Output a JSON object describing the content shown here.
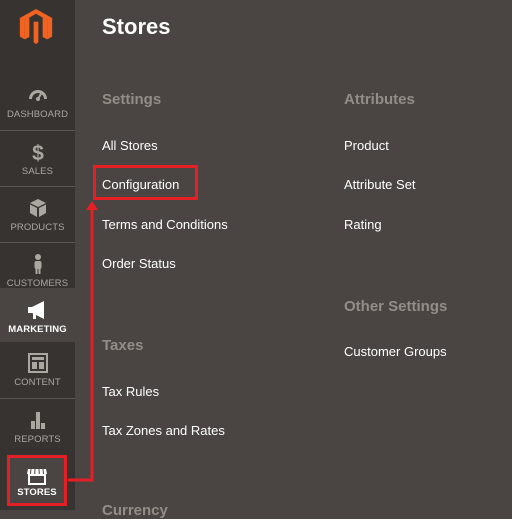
{
  "sidebar": {
    "items": [
      {
        "label": "Dashboard",
        "icon": "dashboard-icon"
      },
      {
        "label": "Sales",
        "icon": "dollar-icon"
      },
      {
        "label": "Products",
        "icon": "box-icon"
      },
      {
        "label": "Customers",
        "icon": "person-icon"
      },
      {
        "label": "Marketing",
        "icon": "megaphone-icon"
      },
      {
        "label": "Content",
        "icon": "layout-icon"
      },
      {
        "label": "Reports",
        "icon": "bar-chart-icon"
      },
      {
        "label": "Stores",
        "icon": "store-icon"
      }
    ]
  },
  "panel": {
    "title": "Stores",
    "settings": {
      "heading": "Settings",
      "links": [
        "All Stores",
        "Configuration",
        "Terms and Conditions",
        "Order Status"
      ]
    },
    "taxes": {
      "heading": "Taxes",
      "links": [
        "Tax Rules",
        "Tax Zones and Rates"
      ]
    },
    "currency": {
      "heading": "Currency"
    },
    "attributes": {
      "heading": "Attributes",
      "links": [
        "Product",
        "Attribute Set",
        "Rating"
      ]
    },
    "other": {
      "heading": "Other Settings",
      "links": [
        "Customer Groups"
      ]
    }
  },
  "colors": {
    "highlight": "#e41f26",
    "logo": "#f26322"
  }
}
